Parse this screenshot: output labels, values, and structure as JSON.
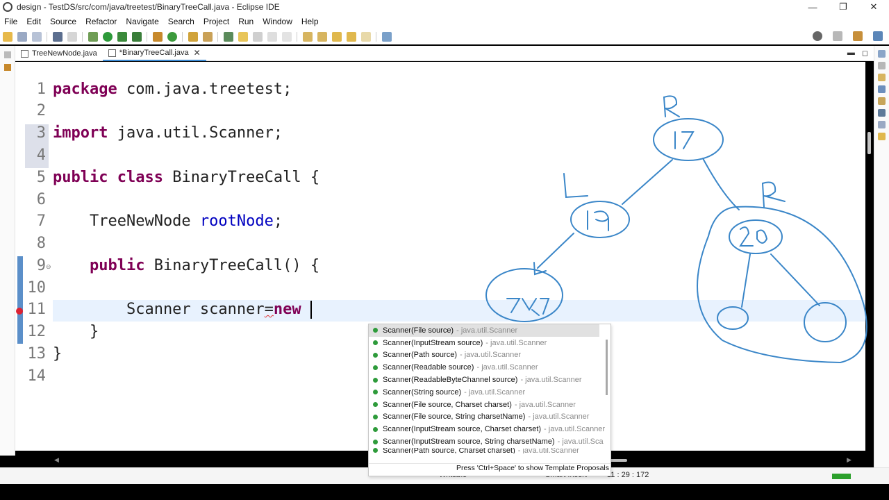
{
  "window": {
    "title": "design - TestDS/src/com/java/treetest/BinaryTreeCall.java - Eclipse IDE",
    "controls": [
      "—",
      "❐",
      "✕"
    ]
  },
  "menu": [
    "File",
    "Edit",
    "Source",
    "Refactor",
    "Navigate",
    "Search",
    "Project",
    "Run",
    "Window",
    "Help"
  ],
  "tabs": [
    {
      "label": "TreeNewNode.java",
      "active": false
    },
    {
      "label": "*BinaryTreeCall.java",
      "active": true
    }
  ],
  "editor": {
    "line_numbers": [
      "1",
      "2",
      "3",
      "4",
      "5",
      "6",
      "7",
      "8",
      "9",
      "10",
      "11",
      "12",
      "13",
      "14"
    ],
    "code": {
      "l1_kw": "package",
      "l1_rest": " com.java.treetest;",
      "l3_kw": "import",
      "l3_rest": " java.util.Scanner;",
      "l5_kw1": "public",
      "l5_kw2": "class",
      "l5_rest": " BinaryTreeCall {",
      "l7_type": "    TreeNewNode ",
      "l7_field": "rootNode",
      "l7_end": ";",
      "l9_indent": "    ",
      "l9_kw": "public",
      "l9_rest": " BinaryTreeCall() {",
      "l11_a": "        Scanner scanner",
      "l11_eq": "=",
      "l11_kw": "new",
      "l11_space": " ",
      "l12": "    }",
      "l13": "}"
    }
  },
  "content_assist": {
    "items": [
      {
        "sig": "Scanner(File source)",
        "pkg": "- java.util.Scanner"
      },
      {
        "sig": "Scanner(InputStream source)",
        "pkg": "- java.util.Scanner"
      },
      {
        "sig": "Scanner(Path source)",
        "pkg": "- java.util.Scanner"
      },
      {
        "sig": "Scanner(Readable source)",
        "pkg": "- java.util.Scanner"
      },
      {
        "sig": "Scanner(ReadableByteChannel source)",
        "pkg": "- java.util.Scanner"
      },
      {
        "sig": "Scanner(String source)",
        "pkg": "- java.util.Scanner"
      },
      {
        "sig": "Scanner(File source, Charset charset)",
        "pkg": "- java.util.Scanner"
      },
      {
        "sig": "Scanner(File source, String charsetName)",
        "pkg": "- java.util.Scanner"
      },
      {
        "sig": "Scanner(InputStream source, Charset charset)",
        "pkg": "- java.util.Scanner"
      },
      {
        "sig": "Scanner(InputStream source, String charsetName)",
        "pkg": "- java.util.Sca"
      },
      {
        "sig": "Scanner(Path source, Charset charset)",
        "pkg": "- java.util.Scanner"
      }
    ],
    "footer": "Press 'Ctrl+Space' to show Template Proposals"
  },
  "status": {
    "writable": "Writable",
    "insert_mode": "Smart Insert",
    "position": "11 : 29 : 172"
  },
  "drawing": {
    "labels": [
      "R",
      "L",
      "R"
    ],
    "nodes": [
      "17",
      "19",
      "717",
      "20"
    ]
  },
  "colors": {
    "keyword": "#7f0055",
    "field": "#0000c0",
    "ink": "#3a86c8",
    "change_bar": "#5b8fc9"
  }
}
